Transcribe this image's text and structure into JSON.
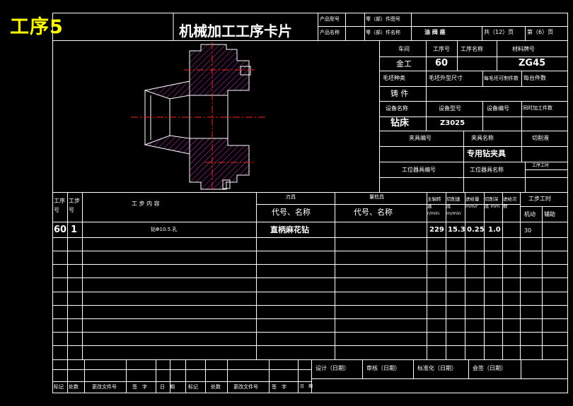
{
  "process_label": "工序5",
  "card_title": "机械加工工序卡片",
  "header": {
    "product_model_label": "产品型号",
    "product_name_label": "产品名称",
    "part_number_label": "零（部）件图号",
    "part_name_label": "零（部）件名称",
    "part_name_value": "油 阀 座",
    "total_pages": "共（12）页",
    "page_no": "第（6）页"
  },
  "info": {
    "workshop_label": "车间",
    "process_no_label": "工序号",
    "process_name_label": "工序名称",
    "material_label": "材料牌号",
    "workshop_value": "金工",
    "process_no_value": "60",
    "material_value": "ZG45",
    "blank_type_label": "毛坯种类",
    "blank_size_label": "毛坯外型尺寸",
    "blank_count_label": "每毛坯可制件数",
    "per_unit_label": "每台件数",
    "blank_type_value": "铸 件",
    "equip_name_label": "设备名称",
    "equip_model_label": "设备型号",
    "equip_no_label": "设备编号",
    "simul_label": "同时加工件数",
    "equip_name_value": "钻床",
    "equip_model_value": "Z3025",
    "fixture_no_label": "夹具编号",
    "fixture_name_label": "夹具名称",
    "coolant_label": "切削液",
    "fixture_name_value": "专用钻夹具",
    "station_no_label": "工位器具编号",
    "station_name_label": "工位器具名称",
    "station_time_label": "工序工时"
  },
  "table": {
    "col_seq": "工序号",
    "col_step": "工步号",
    "col_content": "工 步 内 容",
    "col_tool": "刃具",
    "col_tool_code": "代号、名称",
    "col_gauge": "量检具",
    "col_gauge_code": "代号、名称",
    "col_speed": "主轴转速 r/min",
    "col_cut_speed": "切削速度 m/min",
    "col_feed": "进给量 mm/r",
    "col_depth": "切削深度 mm",
    "col_passes": "进给次数",
    "col_time": "工步工时",
    "col_machine": "机动",
    "col_aux": "辅助",
    "row": {
      "seq": "60",
      "step": "1",
      "content": "钻Φ10.5.孔",
      "tool": "直柄麻花钻",
      "speed": "229",
      "cut_speed": "15.3",
      "feed": "0.25",
      "depth": "1.0",
      "machine_time": "30"
    }
  },
  "footer": {
    "design": "设计（日期）",
    "review": "审核（日期）",
    "standard": "标准化（日期）",
    "countersign": "会签（日期）",
    "mark": "标记",
    "count": "处数",
    "doc_no": "更改文件号",
    "sign": "签　字",
    "date": "日　期",
    "mark2": "标记",
    "count2": "处数",
    "doc_no2": "更改文件号",
    "sign2": "签　字",
    "date2": "日　期"
  },
  "colors": {
    "lines": "#ffffff",
    "title": "#ffff00",
    "hatch": "#cc33cc",
    "center": "#ff0000"
  }
}
